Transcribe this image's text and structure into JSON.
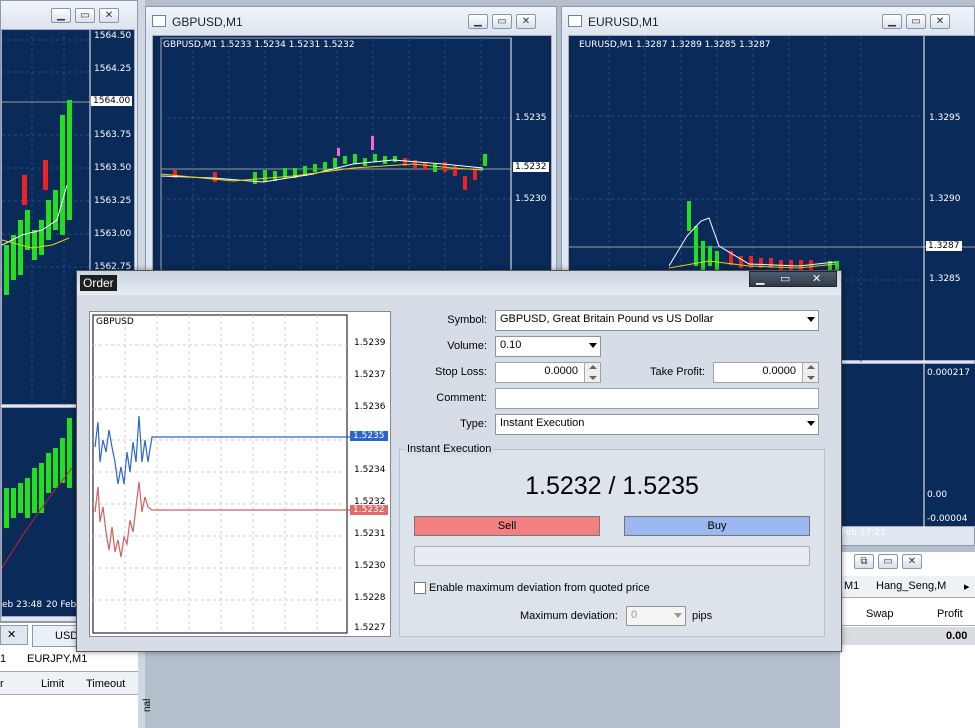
{
  "left_chart": {
    "price_labels": [
      "1564.50",
      "1564.25",
      "1564.00",
      "1563.75",
      "1563.50",
      "1563.25",
      "1563.00",
      "1562.75"
    ],
    "highlight": "1564.00",
    "time_labels": [
      "eb 23:48",
      "20 Feb"
    ]
  },
  "gbp_window": {
    "title": "GBPUSD,M1",
    "header": "GBPUSD,M1  1.5233 1.5234 1.5231 1.5232",
    "price_labels": [
      "1.5235",
      "1.5230"
    ],
    "highlight": "1.5232"
  },
  "eur_window": {
    "title": "EURUSD,M1",
    "header": "EURUSD,M1  1.3287 1.3289 1.3285 1.3287",
    "price_labels": [
      "1.3295",
      "1.3290",
      "1.3285"
    ],
    "highlight": "1.3287",
    "indicator_labels": [
      "0.000217",
      "0.00",
      "-0.00004"
    ],
    "time_label": "Feb 17:21"
  },
  "bottom_left": {
    "tab": "USD",
    "tab2": "EURJPY,M1",
    "col1": "Limit",
    "col2": "Timeout",
    "frag": "r",
    "frag2": "1"
  },
  "bottom_right": {
    "tab1": "M1",
    "tab2": "Hang_Seng,M",
    "col_swap": "Swap",
    "col_profit": "Profit",
    "profit_value": "0.00"
  },
  "order": {
    "title": "Order",
    "mini_chart": {
      "symbol": "GBPUSD",
      "ask_label": "1.5235",
      "bid_label": "1.5232",
      "axis": [
        "1.5239",
        "1.5237",
        "1.5236",
        "1.5234",
        "1.5232",
        "1.5231",
        "1.5230",
        "1.5228",
        "1.5227"
      ]
    },
    "symbol_label": "Symbol:",
    "symbol_value": "GBPUSD, Great Britain Pound vs US Dollar",
    "volume_label": "Volume:",
    "volume_value": "0.10",
    "stop_loss_label": "Stop Loss:",
    "stop_loss_value": "0.0000",
    "take_profit_label": "Take Profit:",
    "take_profit_value": "0.0000",
    "comment_label": "Comment:",
    "comment_value": "",
    "type_label": "Type:",
    "type_value": "Instant Execution",
    "group_title": "Instant Execution",
    "quote": "1.5232 / 1.5235",
    "sell_label": "Sell",
    "buy_label": "Buy",
    "deviation_checkbox_label": "Enable maximum deviation from quoted price",
    "max_deviation_label": "Maximum deviation:",
    "max_deviation_value": "0",
    "pips_label": "pips"
  },
  "side_label": "nal",
  "colors": {
    "chart_bg": "#0a2a5a",
    "sell": "#f28080",
    "buy": "#9bb8f0",
    "bull": "#22dd22",
    "bear": "#ee2222"
  }
}
